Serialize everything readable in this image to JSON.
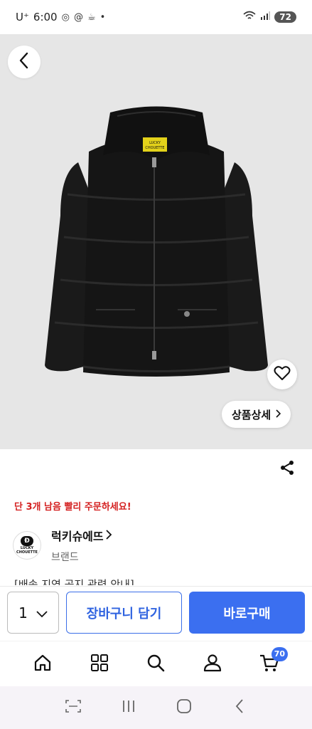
{
  "status_bar": {
    "carrier": "U⁺",
    "time": "6:00",
    "battery": "72"
  },
  "product": {
    "detail_button_label": "상품상세",
    "stock_alert": "단 3개 남음 빨리 주문하세요!",
    "title_partial": "[배송 지연 공지 관련 안내]"
  },
  "brand": {
    "name": "럭키슈에뜨",
    "sub_label": "브랜드",
    "logo_text_line1": "LUCKY",
    "logo_text_line2": "CHOUETTE",
    "tag_text_line1": "LUCKY",
    "tag_text_line2": "CHOUETTE"
  },
  "purchase": {
    "quantity": "1",
    "cart_label": "장바구니 담기",
    "buy_label": "바로구매"
  },
  "bottom_nav": {
    "items": [
      {
        "icon": "home-icon"
      },
      {
        "icon": "category-grid-icon"
      },
      {
        "icon": "search-icon"
      },
      {
        "icon": "profile-icon"
      },
      {
        "icon": "cart-icon"
      }
    ],
    "cart_count": "70"
  },
  "colors": {
    "accent": "#3b6ff0",
    "alert": "#d42020",
    "image_bg": "#e6e6e6"
  }
}
